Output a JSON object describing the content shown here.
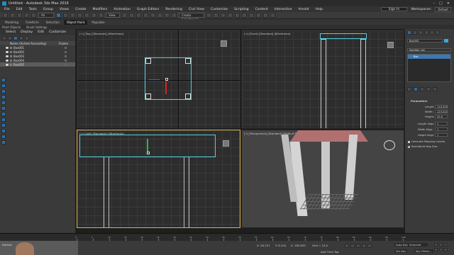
{
  "window": {
    "title": "Untitled - Autodesk 3ds Max 2016"
  },
  "menu": [
    "File",
    "Edit",
    "Tools",
    "Group",
    "Views",
    "Create",
    "Modifiers",
    "Animation",
    "Graph Editors",
    "Rendering",
    "Civil View",
    "Customize",
    "Scripting",
    "Content",
    "Interactive",
    "Arnold",
    "Help"
  ],
  "signin": "Sign In",
  "workspaces": {
    "label": "Workspaces:",
    "value": "Default"
  },
  "toolbar": {
    "view_select": "View",
    "selection_set": "Create Selection Se"
  },
  "ribbon": {
    "tabs": [
      "Modeling",
      "Freeform",
      "Selection",
      "Object Paint",
      "Populate"
    ],
    "active": "Object Paint",
    "sub": [
      "Polygon Modeling"
    ]
  },
  "subribbon": [
    "Paint Objects",
    "Brush Settings"
  ],
  "scene_explorer": {
    "tabs": [
      "Select",
      "Display",
      "Edit",
      "Customize"
    ],
    "header": {
      "name": "Name (Sorted Ascending)",
      "frozen": "Frozen"
    },
    "items": [
      "Box001",
      "Box002",
      "Box003",
      "Box004",
      "Box005"
    ],
    "selected": "Box005"
  },
  "viewports": {
    "top": "[+] [Top] [Standard] [Wireframe]",
    "front": "[+] [Front] [Standard] [Wireframe]",
    "left": "[+] [Left] [Standard] [Wireframe]",
    "perspective": "[+] [Perspective] [Standard] [Default Shading]"
  },
  "command_panel": {
    "object_name": "Box005",
    "modifier_list": "Modifier List",
    "stack_item": "Box",
    "rollout": "Parameters",
    "params": [
      {
        "label": "Length:",
        "value": "110.202"
      },
      {
        "label": "Width:",
        "value": "123.311"
      },
      {
        "label": "Height:",
        "value": "20.0"
      },
      {
        "label": "Length Segs:",
        "value": "1"
      },
      {
        "label": "Width Segs:",
        "value": "1"
      },
      {
        "label": "Height Segs:",
        "value": "1"
      }
    ],
    "checks": [
      "Generate Mapping Coords.",
      "Real-World Map Size"
    ]
  },
  "timeline": {
    "ticks": [
      "0",
      "5",
      "10",
      "15",
      "20",
      "25",
      "30",
      "35",
      "40",
      "45",
      "50",
      "55",
      "60",
      "65",
      "70",
      "75",
      "80",
      "85",
      "90",
      "95",
      "100"
    ]
  },
  "status": {
    "x": "X: 28.157",
    "y": "Y: 6.104",
    "z": "Z: 180.835",
    "grid": "Grid = 10.0",
    "add_time_tag": "Add Time Tag",
    "auto_key": "Auto Key",
    "selected": "Selected",
    "set_key": "Set Key",
    "key_filters": "Key Filters...",
    "welcome": "Default"
  },
  "colors": {
    "selection": "#4fd0e0",
    "active_viewport": "#d8b050",
    "grid": "#3a3a3a"
  }
}
